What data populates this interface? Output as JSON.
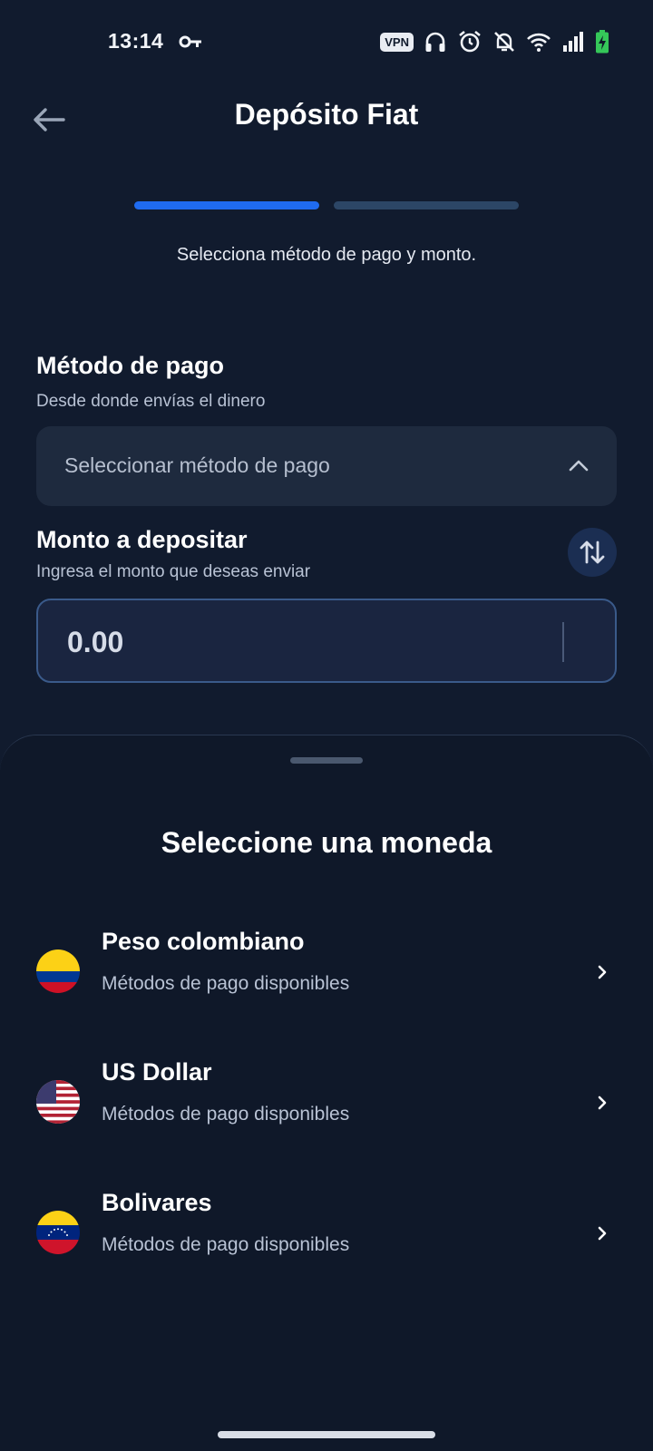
{
  "status_bar": {
    "time": "13:14",
    "vpn_label": "VPN",
    "icons": [
      "key-icon",
      "headphones-icon",
      "alarm-icon",
      "bell-off-icon",
      "wifi-icon",
      "signal-icon",
      "battery-charging-icon"
    ],
    "battery_color": "#35c759"
  },
  "header": {
    "title": "Depósito Fiat",
    "back_icon": "arrow-left-icon"
  },
  "stepper": {
    "total_steps": 2,
    "current_step": 1,
    "caption": "Selecciona método de pago y monto.",
    "active_color": "#1f6bf0",
    "inactive_color": "#2c4666"
  },
  "payment_method": {
    "title": "Método de pago",
    "subtitle": "Desde donde envías el dinero",
    "placeholder": "Seleccionar método de pago"
  },
  "amount": {
    "title": "Monto a depositar",
    "subtitle": "Ingresa el monto que deseas enviar",
    "value": "0.00"
  },
  "sheet": {
    "title": "Seleccione una moneda",
    "currencies": [
      {
        "name": "Peso colombiano",
        "subtitle": "Métodos de pago disponibles",
        "flag": "colombia-flag-icon"
      },
      {
        "name": "US Dollar",
        "subtitle": "Métodos de pago disponibles",
        "flag": "usa-flag-icon"
      },
      {
        "name": "Bolivares",
        "subtitle": "Métodos de pago disponibles",
        "flag": "venezuela-flag-icon"
      }
    ]
  },
  "colors": {
    "background": "#111b2e",
    "sheet_background": "#0f1829",
    "accent": "#1f6bf0"
  }
}
